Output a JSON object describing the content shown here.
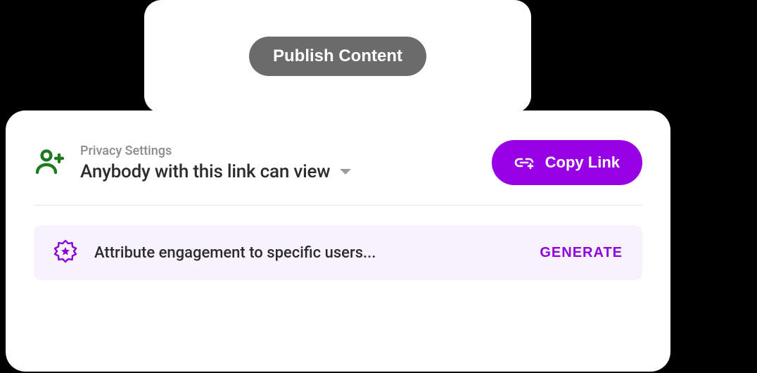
{
  "colors": {
    "primary": "#9700e5",
    "icon_green": "#1f7a1f",
    "banner_bg": "#f8f2fd"
  },
  "top": {
    "publish_label": "Publish Content"
  },
  "privacy": {
    "section_label": "Privacy Settings",
    "value": "Anybody with this link can view",
    "copy_link_label": "Copy Link"
  },
  "attribution": {
    "text": "Attribute engagement to specific users...",
    "generate_label": "GENERATE"
  }
}
